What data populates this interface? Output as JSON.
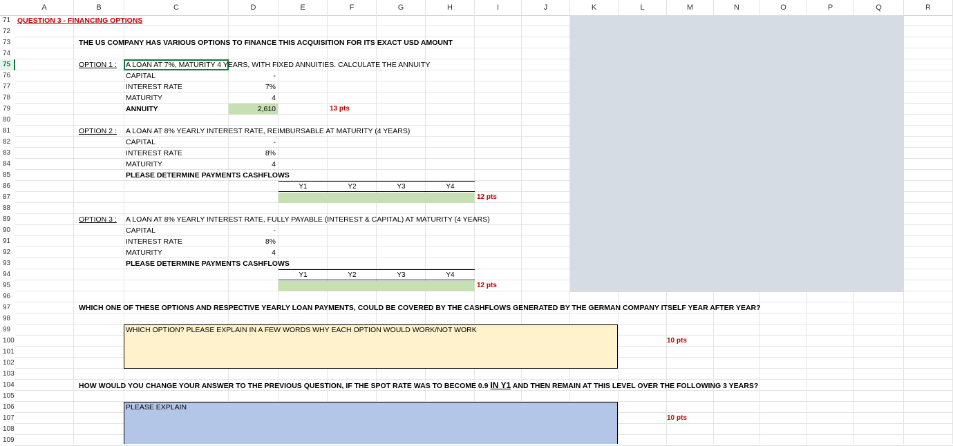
{
  "columns": [
    "A",
    "B",
    "C",
    "D",
    "E",
    "F",
    "G",
    "H",
    "I",
    "J",
    "K",
    "L",
    "M",
    "N",
    "O",
    "P",
    "Q",
    "R"
  ],
  "rows": [
    "71",
    "72",
    "73",
    "74",
    "75",
    "76",
    "77",
    "78",
    "79",
    "80",
    "81",
    "82",
    "83",
    "84",
    "85",
    "86",
    "87",
    "88",
    "89",
    "90",
    "91",
    "92",
    "93",
    "94",
    "95",
    "96",
    "97",
    "98",
    "99",
    "100",
    "101",
    "102",
    "103",
    "104",
    "105",
    "106",
    "107",
    "108",
    "109"
  ],
  "title": "QUESTION 3 - FINANCING OPTIONS",
  "intro": "THE US COMPANY HAS VARIOUS OPTIONS TO FINANCE THIS ACQUISITION FOR ITS EXACT USD AMOUNT",
  "option1": {
    "label": "OPTION 1 :",
    "desc": "A LOAN AT 7%, MATURITY 4 YEARS, WITH FIXED ANNUITIES. CALCULATE THE ANNUITY",
    "capital_label": "CAPITAL",
    "capital_value": "-",
    "rate_label": "INTEREST RATE",
    "rate_value": "7%",
    "maturity_label": "MATURITY",
    "maturity_value": "4",
    "annuity_label": "ANNUITY",
    "annuity_value": "2,610",
    "pts": "13 pts"
  },
  "option2": {
    "label": "OPTION 2 :",
    "desc": "A LOAN AT 8% YEARLY INTEREST RATE, REIMBURSABLE AT MATURITY (4 YEARS)",
    "capital_label": "CAPITAL",
    "capital_value": "-",
    "rate_label": "INTEREST RATE",
    "rate_value": "8%",
    "maturity_label": "MATURITY",
    "maturity_value": "4",
    "cf_label": "PLEASE DETERMINE PAYMENTS CASHFLOWS",
    "years": [
      "Y1",
      "Y2",
      "Y3",
      "Y4"
    ],
    "pts": "12 pts"
  },
  "option3": {
    "label": "OPTION 3 :",
    "desc": "A LOAN AT 8% YEARLY INTEREST RATE, FULLY PAYABLE (INTEREST & CAPITAL) AT MATURITY (4 YEARS)",
    "capital_label": "CAPITAL",
    "capital_value": "-",
    "rate_label": "INTEREST RATE",
    "rate_value": "8%",
    "maturity_label": "MATURITY",
    "maturity_value": "4",
    "cf_label": "PLEASE DETERMINE PAYMENTS CASHFLOWS",
    "years": [
      "Y1",
      "Y2",
      "Y3",
      "Y4"
    ],
    "pts": "12 pts"
  },
  "question1": {
    "text": "WHICH ONE OF THESE OPTIONS AND RESPECTIVE YEARLY LOAN PAYMENTS, COULD BE COVERED BY THE CASHFLOWS GENERATED BY THE GERMAN COMPANY ITSELF YEAR AFTER YEAR?",
    "box_text": "WHICH OPTION? PLEASE EXPLAIN IN A FEW WORDS WHY EACH OPTION WOULD WORK/NOT WORK",
    "pts": "10 pts"
  },
  "question2": {
    "text_a": "HOW WOULD YOU CHANGE YOUR ANSWER TO THE PREVIOUS QUESTION, IF THE SPOT RATE WAS TO BECOME 0.9 ",
    "text_b": "IN Y1",
    "text_c": " AND THEN REMAIN AT THIS LEVEL OVER THE FOLLOWING 3 YEARS?",
    "box_text": "PLEASE EXPLAIN",
    "pts": "10 pts"
  },
  "colors": {
    "green_fill": "#c6e0b4",
    "yellow_fill": "#fff2cc",
    "blue_fill": "#b4c6e7",
    "grey_block": "#d6dce4",
    "points_red": "#c00000",
    "selection_green": "#107c41"
  }
}
